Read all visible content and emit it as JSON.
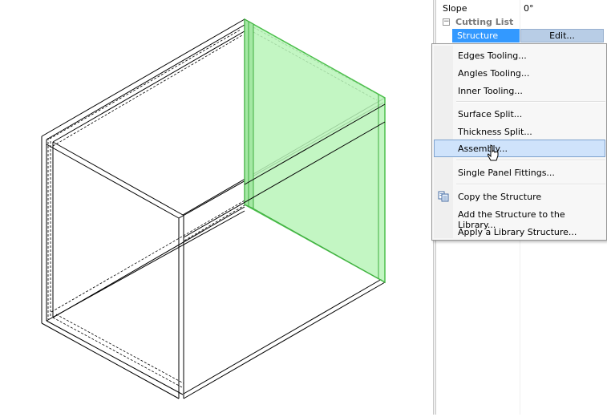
{
  "properties": {
    "slope": {
      "name": "Slope",
      "value": "0°"
    },
    "category": {
      "label": "Cutting List",
      "toggle": "−"
    },
    "structure": {
      "name": "Structure",
      "edit_label": "Edit..."
    }
  },
  "context_menu": {
    "items": [
      {
        "label": "Edges Tooling..."
      },
      {
        "label": "Angles Tooling..."
      },
      {
        "label": "Inner Tooling..."
      },
      {
        "label": "Surface Split..."
      },
      {
        "label": "Thickness Split..."
      },
      {
        "label": "Assembly...",
        "highlighted": true
      },
      {
        "label": "Single Panel Fittings..."
      },
      {
        "label": "Copy the Structure",
        "icon": "copy-icon"
      },
      {
        "label": "Add the Structure to the Library..."
      },
      {
        "label": "Apply a Library Structure..."
      }
    ]
  },
  "colors": {
    "selected_panel": "#b8f5b8",
    "selected_panel_edge": "#4cbf4c",
    "menu_highlight": "#cfe3fb",
    "selection": "#3399ff"
  }
}
